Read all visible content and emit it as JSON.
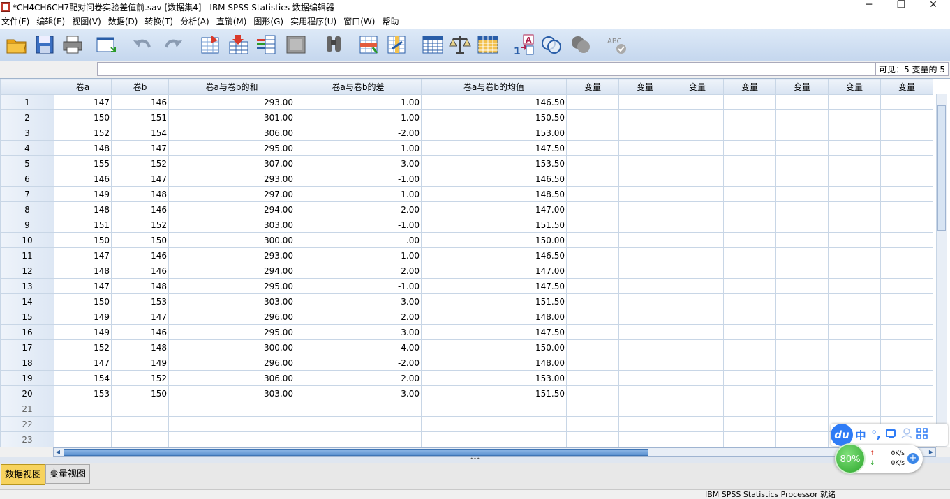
{
  "window": {
    "title": "*CH4CH6CH7配对问卷实验差值前.sav [数据集4] - IBM SPSS Statistics 数据编辑器",
    "minimize": "─",
    "restore": "❐",
    "close": "✕"
  },
  "menus": [
    "文件(F)",
    "编辑(E)",
    "视图(V)",
    "数据(D)",
    "转换(T)",
    "分析(A)",
    "直销(M)",
    "图形(G)",
    "实用程序(U)",
    "窗口(W)",
    "帮助"
  ],
  "toolbar_icons": [
    "open-folder-icon",
    "save-icon",
    "print-icon",
    "dialog-recall-icon",
    "undo-icon",
    "redo-icon",
    "goto-case-icon",
    "goto-variable-icon",
    "variables-icon",
    "chart-icon",
    "find-icon",
    "insert-cases-icon",
    "insert-variable-icon",
    "split-file-icon",
    "weight-cases-icon",
    "select-cases-icon",
    "value-labels-icon",
    "use-sets-icon",
    "show-all-variables-icon",
    "spell-check-icon"
  ],
  "editbar": {
    "cell_ref": "",
    "cell_value": "",
    "visible": "可见：5 变量的 5"
  },
  "columns": [
    "卷a",
    "卷b",
    "卷a与卷b的和",
    "卷a与卷b的差",
    "卷a与卷b的均值",
    "变量",
    "变量",
    "变量",
    "变量",
    "变量",
    "变量",
    "变量"
  ],
  "rows": [
    {
      "n": "1",
      "v": [
        "147",
        "146",
        "293.00",
        "1.00",
        "146.50"
      ]
    },
    {
      "n": "2",
      "v": [
        "150",
        "151",
        "301.00",
        "-1.00",
        "150.50"
      ]
    },
    {
      "n": "3",
      "v": [
        "152",
        "154",
        "306.00",
        "-2.00",
        "153.00"
      ]
    },
    {
      "n": "4",
      "v": [
        "148",
        "147",
        "295.00",
        "1.00",
        "147.50"
      ]
    },
    {
      "n": "5",
      "v": [
        "155",
        "152",
        "307.00",
        "3.00",
        "153.50"
      ]
    },
    {
      "n": "6",
      "v": [
        "146",
        "147",
        "293.00",
        "-1.00",
        "146.50"
      ]
    },
    {
      "n": "7",
      "v": [
        "149",
        "148",
        "297.00",
        "1.00",
        "148.50"
      ]
    },
    {
      "n": "8",
      "v": [
        "148",
        "146",
        "294.00",
        "2.00",
        "147.00"
      ]
    },
    {
      "n": "9",
      "v": [
        "151",
        "152",
        "303.00",
        "-1.00",
        "151.50"
      ]
    },
    {
      "n": "10",
      "v": [
        "150",
        "150",
        "300.00",
        ".00",
        "150.00"
      ]
    },
    {
      "n": "11",
      "v": [
        "147",
        "146",
        "293.00",
        "1.00",
        "146.50"
      ]
    },
    {
      "n": "12",
      "v": [
        "148",
        "146",
        "294.00",
        "2.00",
        "147.00"
      ]
    },
    {
      "n": "13",
      "v": [
        "147",
        "148",
        "295.00",
        "-1.00",
        "147.50"
      ]
    },
    {
      "n": "14",
      "v": [
        "150",
        "153",
        "303.00",
        "-3.00",
        "151.50"
      ]
    },
    {
      "n": "15",
      "v": [
        "149",
        "147",
        "296.00",
        "2.00",
        "148.00"
      ]
    },
    {
      "n": "16",
      "v": [
        "149",
        "146",
        "295.00",
        "3.00",
        "147.50"
      ]
    },
    {
      "n": "17",
      "v": [
        "152",
        "148",
        "300.00",
        "4.00",
        "150.00"
      ]
    },
    {
      "n": "18",
      "v": [
        "147",
        "149",
        "296.00",
        "-2.00",
        "148.00"
      ]
    },
    {
      "n": "19",
      "v": [
        "154",
        "152",
        "306.00",
        "2.00",
        "153.00"
      ]
    },
    {
      "n": "20",
      "v": [
        "153",
        "150",
        "303.00",
        "3.00",
        "151.50"
      ]
    }
  ],
  "empty_rows": [
    "21",
    "22",
    "23"
  ],
  "tabs": {
    "data_view": "数据视图",
    "variable_view": "变量视图"
  },
  "status": "IBM SPSS Statistics Processor 就绪",
  "ime": {
    "logo": "du",
    "lang": "中",
    "punct": "°,"
  },
  "net": {
    "percent": "80%",
    "up": "0K/s",
    "down": "0K/s",
    "up_arrow": "↑",
    "down_arrow": "↓",
    "plus": "+"
  }
}
